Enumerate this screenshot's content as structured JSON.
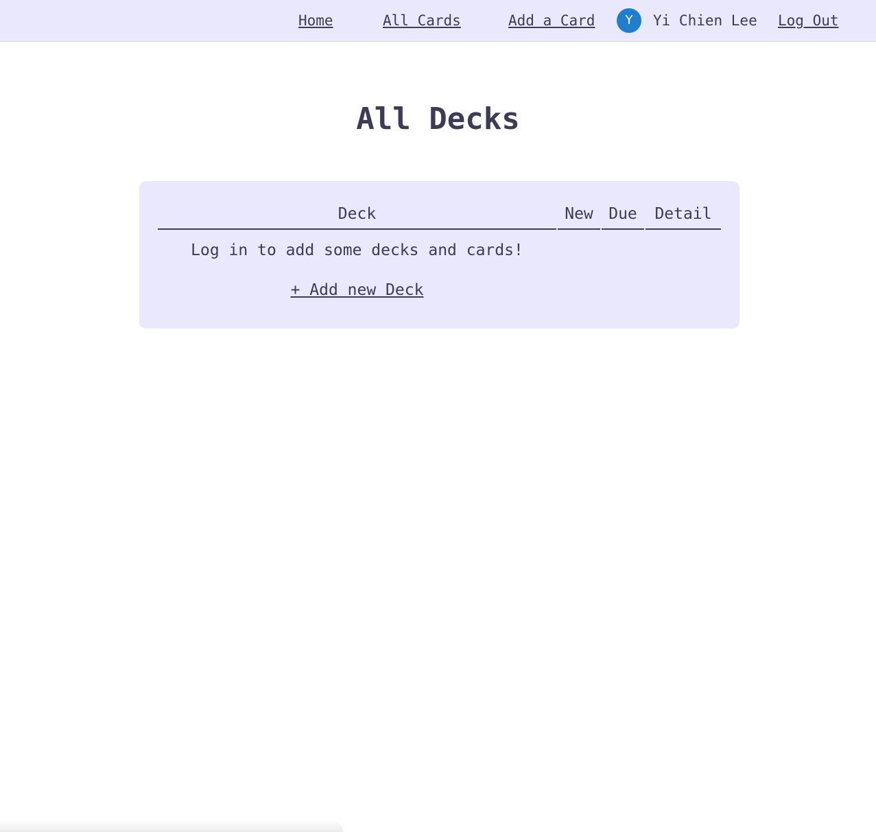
{
  "nav": {
    "home": "Home",
    "all_cards": "All Cards",
    "add_card": "Add a Card",
    "avatar_initial": "Y",
    "user_name": "Yi Chien Lee",
    "logout": "Log Out"
  },
  "page": {
    "title": "All Decks"
  },
  "deck_table": {
    "columns": [
      "Deck",
      "New",
      "Due",
      "Detail"
    ],
    "empty_message": "Log in to add some decks and cards!",
    "add_deck_label": "+ Add new Deck"
  },
  "colors": {
    "nav_background": "#e9e8fd",
    "panel_background": "#e9e8fd",
    "text": "#3d3b55",
    "avatar": "#1e7fcd"
  }
}
